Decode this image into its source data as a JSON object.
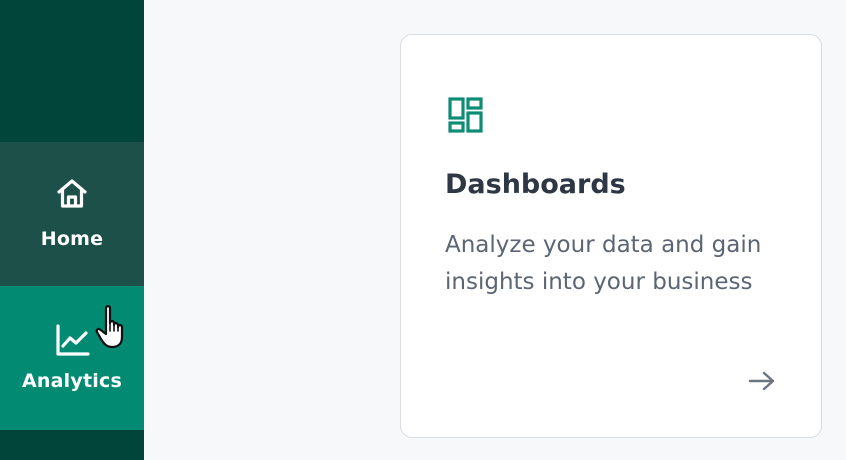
{
  "sidebar": {
    "items": [
      {
        "label": "Home",
        "icon": "home-icon",
        "state": "hover"
      },
      {
        "label": "Analytics",
        "icon": "line-chart-icon",
        "state": "active"
      }
    ]
  },
  "card": {
    "icon": "dashboard-grid-icon",
    "title": "Dashboards",
    "description": "Analyze your data and gain insights into your business",
    "arrow_icon": "arrow-right-icon"
  },
  "colors": {
    "sidebar_bg": "#01443a",
    "home_hover_bg": "#1d5049",
    "analytics_active_bg": "#028a73",
    "accent": "#0f8c74",
    "title_text": "#2e3743",
    "body_text": "#5b6573"
  }
}
